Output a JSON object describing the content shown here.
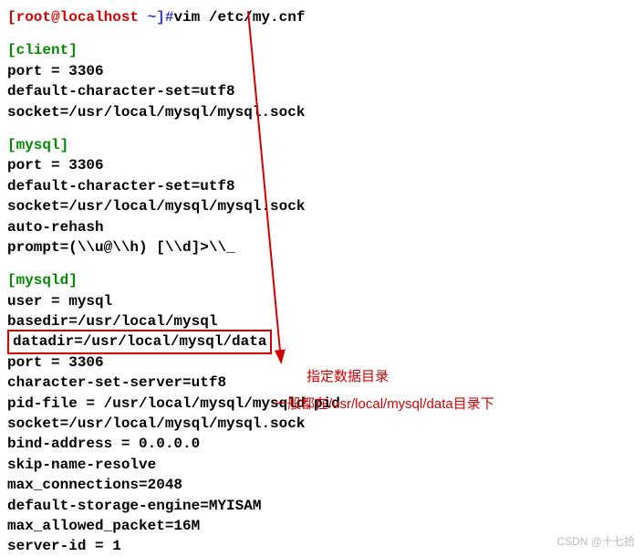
{
  "prompt": {
    "user_host": "[root@localhost",
    "tilde": " ~]#",
    "command": "vim /etc/my.cnf"
  },
  "blocks": {
    "client": {
      "header": "[client]",
      "lines": [
        "port = 3306",
        "default-character-set=utf8",
        "socket=/usr/local/mysql/mysql.sock"
      ]
    },
    "mysql": {
      "header": "[mysql]",
      "lines": [
        "port = 3306",
        "default-character-set=utf8",
        "socket=/usr/local/mysql/mysql.sock",
        "auto-rehash",
        "prompt=(\\\\u@\\\\h) [\\\\d]>\\\\_"
      ]
    },
    "mysqld": {
      "header": "[mysqld]",
      "pre": [
        "user = mysql",
        "basedir=/usr/local/mysql"
      ],
      "datadir": "datadir=/usr/local/mysql/data",
      "post": [
        "port = 3306",
        "character-set-server=utf8",
        "pid-file = /usr/local/mysql/mysqld.pid",
        "socket=/usr/local/mysql/mysql.sock",
        "bind-address = 0.0.0.0",
        "skip-name-resolve",
        "max_connections=2048",
        "default-storage-engine=MYISAM",
        "max_allowed_packet=16M",
        "server-id = 1"
      ]
    }
  },
  "annotations": {
    "label1": "指定数据目录",
    "label2": "一般都在/usr/local/mysql/data目录下"
  },
  "watermark": "CSDN @十七拾"
}
